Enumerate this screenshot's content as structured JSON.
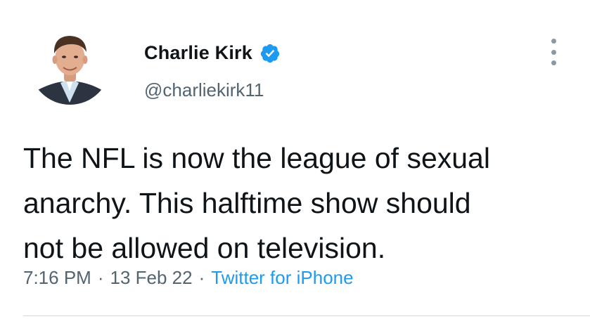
{
  "author": {
    "display_name": "Charlie Kirk",
    "handle": "@charliekirk11",
    "verified": true
  },
  "tweet": {
    "text": "The NFL is now the league of sexual\nanarchy. This halftime show should\nnot be allowed on television.",
    "time": "7:16 PM",
    "separator": "·",
    "date": "13 Feb 22",
    "source": "Twitter for iPhone"
  },
  "icons": {
    "verified": "verified-badge-icon",
    "more": "more-options-icon"
  },
  "colors": {
    "text": "#0f1419",
    "secondary_text": "#536471",
    "link": "#1d9bf0",
    "verified": "#1d9bf0",
    "divider": "#cfd9de"
  }
}
